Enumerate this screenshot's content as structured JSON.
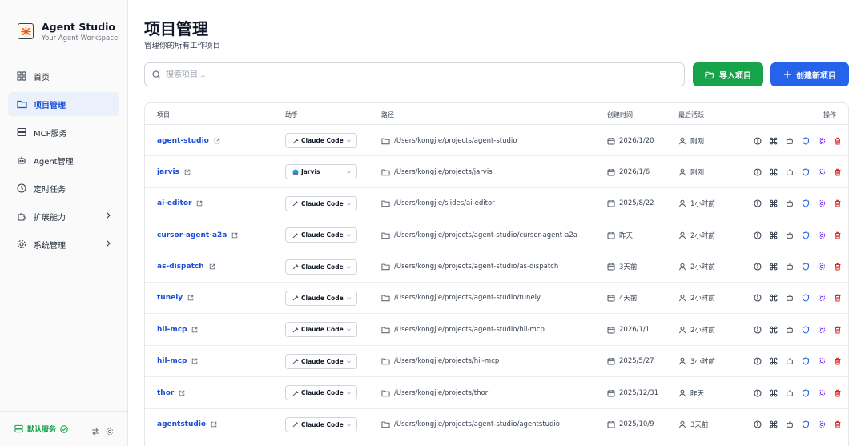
{
  "brand": {
    "title": "Agent Studio",
    "subtitle": "Your Agent Workspace"
  },
  "nav": [
    {
      "label": "首页",
      "icon": "grid-icon"
    },
    {
      "label": "项目管理",
      "icon": "folder-icon",
      "active": true
    },
    {
      "label": "MCP服务",
      "icon": "server-icon"
    },
    {
      "label": "Agent管理",
      "icon": "bot-icon"
    },
    {
      "label": "定时任务",
      "icon": "clock-icon"
    },
    {
      "label": "扩展能力",
      "icon": "puzzle-icon",
      "expandable": true
    },
    {
      "label": "系统管理",
      "icon": "gear-icon",
      "expandable": true
    }
  ],
  "footer": {
    "service_label": "默认服务",
    "service_status": "ok"
  },
  "header": {
    "title": "项目管理",
    "subtitle": "管理你的所有工作项目"
  },
  "search": {
    "placeholder": "搜索项目..."
  },
  "buttons": {
    "import": "导入项目",
    "create": "创建新项目"
  },
  "table": {
    "columns": {
      "name": "项目",
      "agent": "助手",
      "path": "路径",
      "created": "创建时间",
      "active": "最后活跃",
      "ops": "操作"
    },
    "rows": [
      {
        "name": "agent-studio",
        "agent": "Claude Code",
        "path": "/Users/kongjie/projects/agent-studio",
        "created": "2026/1/20",
        "active": "刚刚"
      },
      {
        "name": "jarvis",
        "agent": "Jarvis",
        "path": "/Users/kongjie/projects/jarvis",
        "created": "2026/1/6",
        "active": "刚刚"
      },
      {
        "name": "ai-editor",
        "agent": "Claude Code",
        "path": "/Users/kongjie/slides/ai-editor",
        "created": "2025/8/22",
        "active": "1小时前"
      },
      {
        "name": "cursor-agent-a2a",
        "agent": "Claude Code",
        "path": "/Users/kongjie/projects/agent-studio/cursor-agent-a2a",
        "created": "昨天",
        "active": "2小时前"
      },
      {
        "name": "as-dispatch",
        "agent": "Claude Code",
        "path": "/Users/kongjie/projects/agent-studio/as-dispatch",
        "created": "3天前",
        "active": "2小时前"
      },
      {
        "name": "tunely",
        "agent": "Claude Code",
        "path": "/Users/kongjie/projects/agent-studio/tunely",
        "created": "4天前",
        "active": "2小时前"
      },
      {
        "name": "hil-mcp",
        "agent": "Claude Code",
        "path": "/Users/kongjie/projects/agent-studio/hil-mcp",
        "created": "2026/1/1",
        "active": "2小时前"
      },
      {
        "name": "hil-mcp",
        "agent": "Claude Code",
        "path": "/Users/kongjie/projects/hil-mcp",
        "created": "2025/5/27",
        "active": "3小时前"
      },
      {
        "name": "thor",
        "agent": "Claude Code",
        "path": "/Users/kongjie/projects/thor",
        "created": "2025/12/31",
        "active": "昨天"
      },
      {
        "name": "agentstudio",
        "agent": "Claude Code",
        "path": "/Users/kongjie/projects/agent-studio/agentstudio",
        "created": "2025/10/9",
        "active": "3天前"
      }
    ]
  },
  "colors": {
    "primary": "#2563eb",
    "success": "#16a34a",
    "danger": "#dc2626",
    "purple": "#7c3aed"
  }
}
